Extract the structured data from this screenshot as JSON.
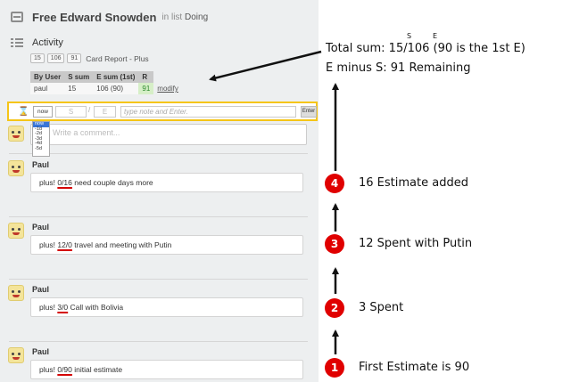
{
  "card": {
    "title": "Free Edward Snowden",
    "list_prefix": "in list",
    "list_name": "Doing"
  },
  "activity": {
    "label": "Activity",
    "badges": [
      "15",
      "106",
      "91"
    ],
    "report_label": "Card Report - Plus"
  },
  "sum_table": {
    "headers": [
      "By User",
      "S sum",
      "E sum (1st)",
      "R"
    ],
    "row": [
      "paul",
      "15",
      "106 (90)",
      "91"
    ],
    "link": "modify"
  },
  "entry_bar": {
    "now": "now",
    "s_placeholder": "S",
    "e_placeholder": "E",
    "slash": "/",
    "note_placeholder": "type note and Enter.",
    "enter": "Enter"
  },
  "time_options": [
    "now",
    "-1d",
    "-2d",
    "-3d",
    "-4d",
    "-5d"
  ],
  "comment_placeholder": "Write a comment...",
  "entries": [
    {
      "author": "Paul",
      "prefix": "plus!",
      "value": "0/16",
      "note": "need couple days more"
    },
    {
      "author": "Paul",
      "prefix": "plus!",
      "value": "12/0",
      "note": "travel and meeting with Putin"
    },
    {
      "author": "Paul",
      "prefix": "plus!",
      "value": "3/0",
      "note": "Call with Bolivia"
    },
    {
      "author": "Paul",
      "prefix": "plus!",
      "value": "0/90",
      "note": "initial estimate"
    }
  ],
  "annotations": {
    "total": {
      "s_label": "S",
      "e_label": "E",
      "line1": "Total sum: 15/106  (90 is the 1st  E)",
      "line2": "E minus S: 91  Remaining"
    },
    "steps": [
      {
        "num": "4",
        "text": "16  Estimate added"
      },
      {
        "num": "3",
        "text": "12 Spent with Putin"
      },
      {
        "num": "2",
        "text": "3 Spent"
      },
      {
        "num": "1",
        "text": "First  Estimate is 90"
      }
    ]
  },
  "colors": {
    "highlight_border": "#f5c518",
    "step_red": "#e00000",
    "underline_red": "#d40000",
    "remaining_green": "#2e8a2e"
  }
}
